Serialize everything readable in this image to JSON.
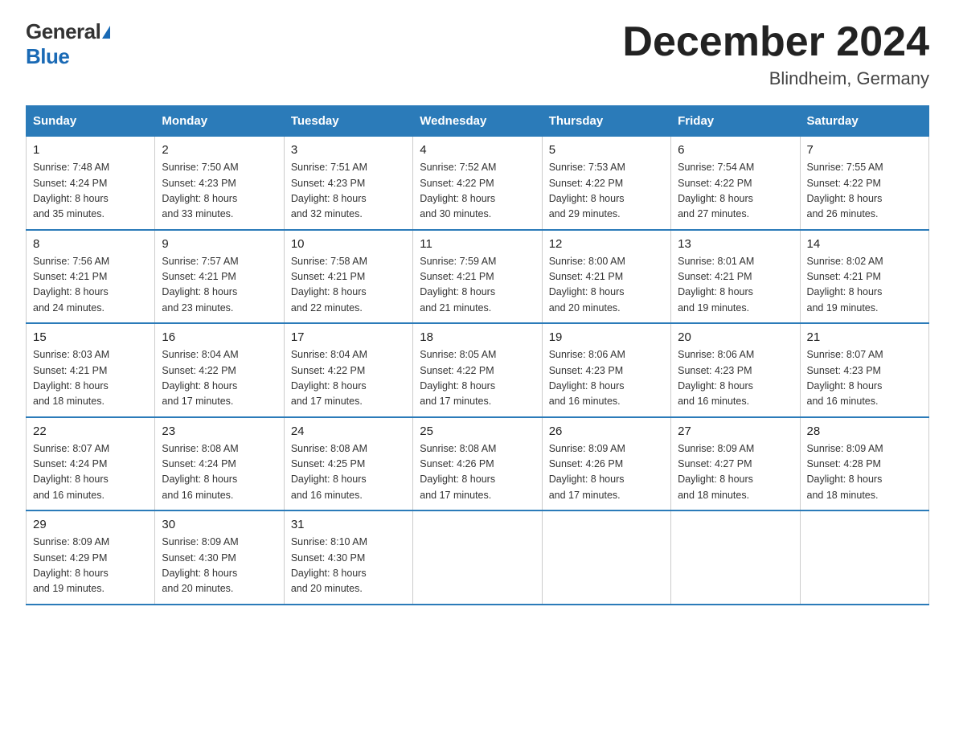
{
  "header": {
    "logo_general": "General",
    "logo_blue": "Blue",
    "month_title": "December 2024",
    "location": "Blindheim, Germany"
  },
  "columns": [
    "Sunday",
    "Monday",
    "Tuesday",
    "Wednesday",
    "Thursday",
    "Friday",
    "Saturday"
  ],
  "weeks": [
    [
      {
        "day": "1",
        "sunrise": "7:48 AM",
        "sunset": "4:24 PM",
        "daylight": "8 hours and 35 minutes."
      },
      {
        "day": "2",
        "sunrise": "7:50 AM",
        "sunset": "4:23 PM",
        "daylight": "8 hours and 33 minutes."
      },
      {
        "day": "3",
        "sunrise": "7:51 AM",
        "sunset": "4:23 PM",
        "daylight": "8 hours and 32 minutes."
      },
      {
        "day": "4",
        "sunrise": "7:52 AM",
        "sunset": "4:22 PM",
        "daylight": "8 hours and 30 minutes."
      },
      {
        "day": "5",
        "sunrise": "7:53 AM",
        "sunset": "4:22 PM",
        "daylight": "8 hours and 29 minutes."
      },
      {
        "day": "6",
        "sunrise": "7:54 AM",
        "sunset": "4:22 PM",
        "daylight": "8 hours and 27 minutes."
      },
      {
        "day": "7",
        "sunrise": "7:55 AM",
        "sunset": "4:22 PM",
        "daylight": "8 hours and 26 minutes."
      }
    ],
    [
      {
        "day": "8",
        "sunrise": "7:56 AM",
        "sunset": "4:21 PM",
        "daylight": "8 hours and 24 minutes."
      },
      {
        "day": "9",
        "sunrise": "7:57 AM",
        "sunset": "4:21 PM",
        "daylight": "8 hours and 23 minutes."
      },
      {
        "day": "10",
        "sunrise": "7:58 AM",
        "sunset": "4:21 PM",
        "daylight": "8 hours and 22 minutes."
      },
      {
        "day": "11",
        "sunrise": "7:59 AM",
        "sunset": "4:21 PM",
        "daylight": "8 hours and 21 minutes."
      },
      {
        "day": "12",
        "sunrise": "8:00 AM",
        "sunset": "4:21 PM",
        "daylight": "8 hours and 20 minutes."
      },
      {
        "day": "13",
        "sunrise": "8:01 AM",
        "sunset": "4:21 PM",
        "daylight": "8 hours and 19 minutes."
      },
      {
        "day": "14",
        "sunrise": "8:02 AM",
        "sunset": "4:21 PM",
        "daylight": "8 hours and 19 minutes."
      }
    ],
    [
      {
        "day": "15",
        "sunrise": "8:03 AM",
        "sunset": "4:21 PM",
        "daylight": "8 hours and 18 minutes."
      },
      {
        "day": "16",
        "sunrise": "8:04 AM",
        "sunset": "4:22 PM",
        "daylight": "8 hours and 17 minutes."
      },
      {
        "day": "17",
        "sunrise": "8:04 AM",
        "sunset": "4:22 PM",
        "daylight": "8 hours and 17 minutes."
      },
      {
        "day": "18",
        "sunrise": "8:05 AM",
        "sunset": "4:22 PM",
        "daylight": "8 hours and 17 minutes."
      },
      {
        "day": "19",
        "sunrise": "8:06 AM",
        "sunset": "4:23 PM",
        "daylight": "8 hours and 16 minutes."
      },
      {
        "day": "20",
        "sunrise": "8:06 AM",
        "sunset": "4:23 PM",
        "daylight": "8 hours and 16 minutes."
      },
      {
        "day": "21",
        "sunrise": "8:07 AM",
        "sunset": "4:23 PM",
        "daylight": "8 hours and 16 minutes."
      }
    ],
    [
      {
        "day": "22",
        "sunrise": "8:07 AM",
        "sunset": "4:24 PM",
        "daylight": "8 hours and 16 minutes."
      },
      {
        "day": "23",
        "sunrise": "8:08 AM",
        "sunset": "4:24 PM",
        "daylight": "8 hours and 16 minutes."
      },
      {
        "day": "24",
        "sunrise": "8:08 AM",
        "sunset": "4:25 PM",
        "daylight": "8 hours and 16 minutes."
      },
      {
        "day": "25",
        "sunrise": "8:08 AM",
        "sunset": "4:26 PM",
        "daylight": "8 hours and 17 minutes."
      },
      {
        "day": "26",
        "sunrise": "8:09 AM",
        "sunset": "4:26 PM",
        "daylight": "8 hours and 17 minutes."
      },
      {
        "day": "27",
        "sunrise": "8:09 AM",
        "sunset": "4:27 PM",
        "daylight": "8 hours and 18 minutes."
      },
      {
        "day": "28",
        "sunrise": "8:09 AM",
        "sunset": "4:28 PM",
        "daylight": "8 hours and 18 minutes."
      }
    ],
    [
      {
        "day": "29",
        "sunrise": "8:09 AM",
        "sunset": "4:29 PM",
        "daylight": "8 hours and 19 minutes."
      },
      {
        "day": "30",
        "sunrise": "8:09 AM",
        "sunset": "4:30 PM",
        "daylight": "8 hours and 20 minutes."
      },
      {
        "day": "31",
        "sunrise": "8:10 AM",
        "sunset": "4:30 PM",
        "daylight": "8 hours and 20 minutes."
      },
      null,
      null,
      null,
      null
    ]
  ]
}
